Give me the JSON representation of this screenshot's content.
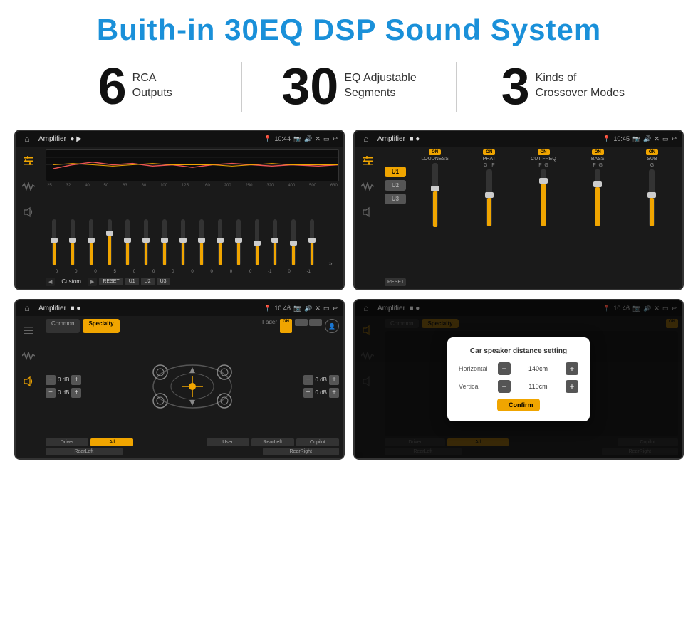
{
  "header": {
    "title": "Buith-in 30EQ DSP Sound System"
  },
  "stats": [
    {
      "number": "6",
      "line1": "RCA",
      "line2": "Outputs"
    },
    {
      "number": "30",
      "line1": "EQ Adjustable",
      "line2": "Segments"
    },
    {
      "number": "3",
      "line1": "Kinds of",
      "line2": "Crossover Modes"
    }
  ],
  "screens": [
    {
      "id": "eq-screen",
      "status_bar": {
        "app": "Amplifier",
        "time": "10:44"
      }
    },
    {
      "id": "crossover-screen",
      "status_bar": {
        "app": "Amplifier",
        "time": "10:45"
      }
    },
    {
      "id": "fader-screen",
      "status_bar": {
        "app": "Amplifier",
        "time": "10:46"
      }
    },
    {
      "id": "dialog-screen",
      "status_bar": {
        "app": "Amplifier",
        "time": "10:46"
      },
      "dialog": {
        "title": "Car speaker distance setting",
        "horizontal_label": "Horizontal",
        "horizontal_value": "140cm",
        "vertical_label": "Vertical",
        "vertical_value": "110cm",
        "confirm_label": "Confirm"
      }
    }
  ],
  "eq": {
    "frequencies": [
      "25",
      "32",
      "40",
      "50",
      "63",
      "80",
      "100",
      "125",
      "160",
      "200",
      "250",
      "320",
      "400",
      "500",
      "630"
    ],
    "values": [
      "0",
      "0",
      "0",
      "5",
      "0",
      "0",
      "0",
      "0",
      "0",
      "0",
      "0",
      "-1",
      "0",
      "-1"
    ],
    "preset": "Custom",
    "buttons": [
      "RESET",
      "U1",
      "U2",
      "U3"
    ]
  },
  "crossover": {
    "presets": [
      "U1",
      "U2",
      "U3"
    ],
    "channels": [
      "LOUDNESS",
      "PHAT",
      "CUT FREQ",
      "BASS",
      "SUB"
    ],
    "reset": "RESET"
  },
  "fader": {
    "tabs": [
      "Common",
      "Specialty"
    ],
    "fader_label": "Fader",
    "on_label": "ON",
    "vol_labels": [
      "0 dB",
      "0 dB",
      "0 dB",
      "0 dB"
    ],
    "bottom_btns": [
      "Driver",
      "All",
      "User",
      "RearLeft",
      "RearRight",
      "Copilot"
    ]
  },
  "dialog": {
    "title": "Car speaker distance setting",
    "horizontal_label": "Horizontal",
    "horizontal_value": "140cm",
    "vertical_label": "Vertical",
    "vertical_value": "110cm",
    "confirm_label": "Confirm"
  }
}
